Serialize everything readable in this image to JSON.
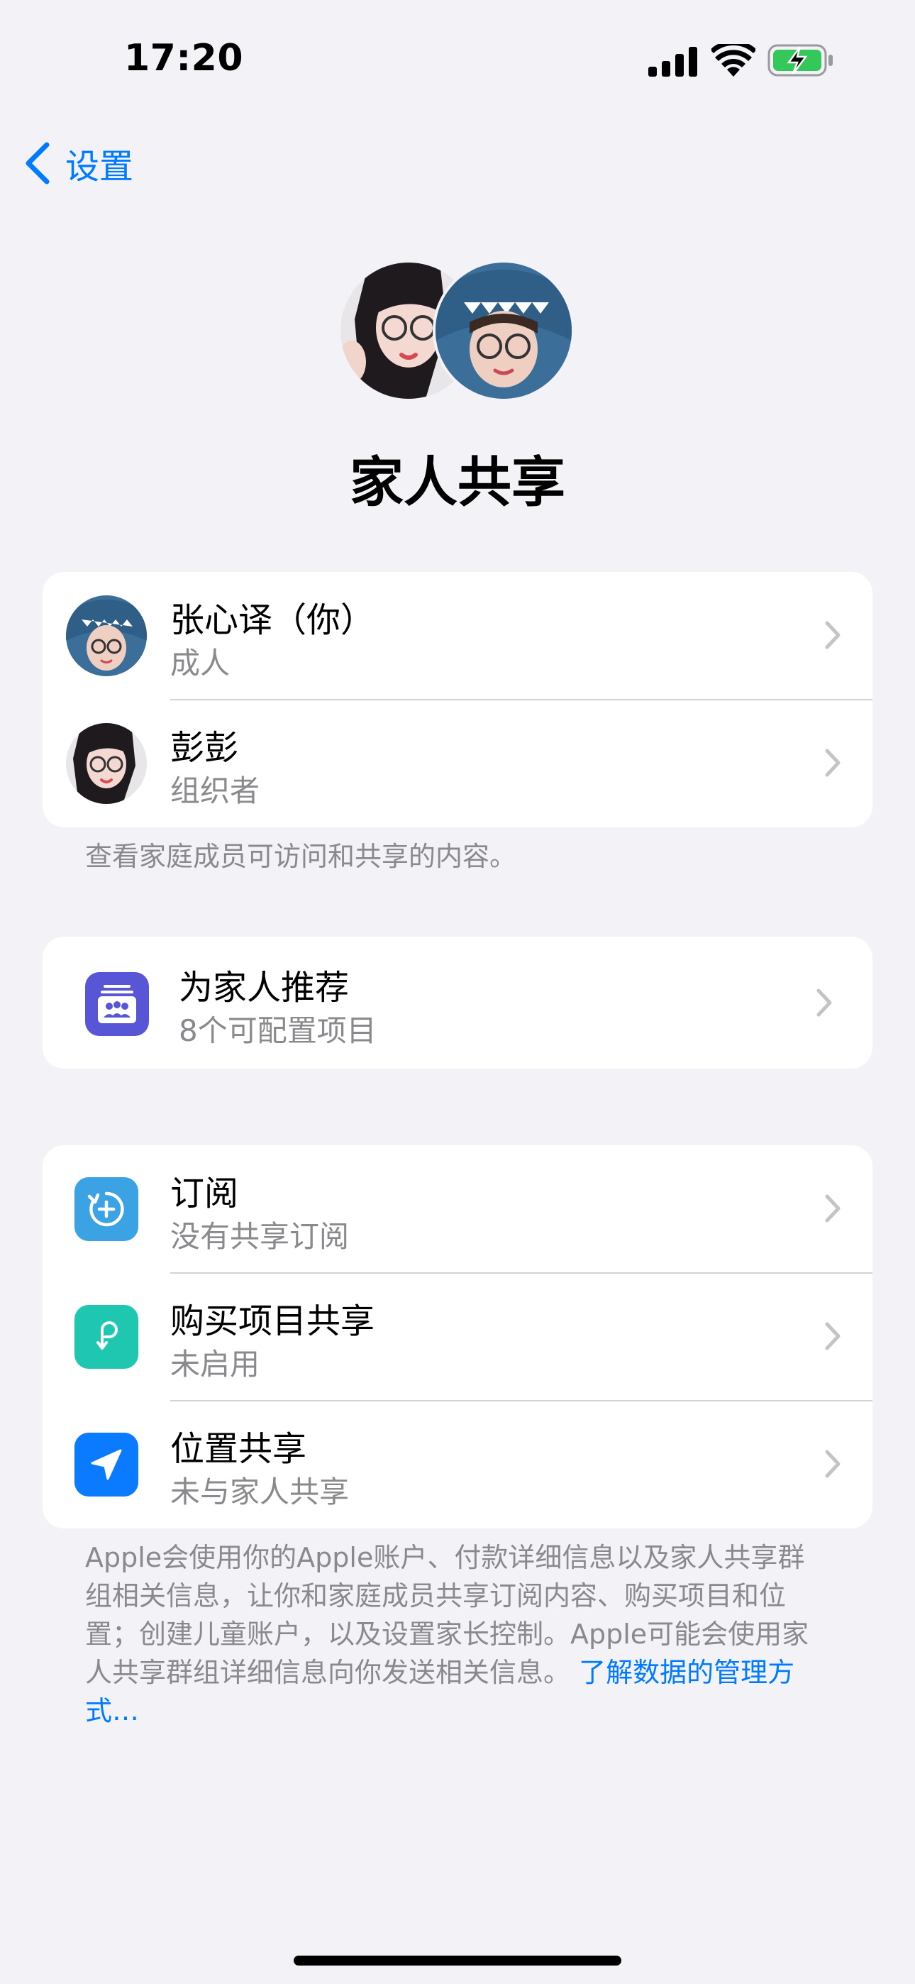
{
  "status_bar": {
    "time": "17:20"
  },
  "nav": {
    "back_label": "设置",
    "back_icon": "chevron-left-icon"
  },
  "header": {
    "title": "家人共享"
  },
  "members": [
    {
      "name": "张心译（你）",
      "role": "成人"
    },
    {
      "name": "彭彭",
      "role": "组织者"
    }
  ],
  "members_note": "查看家庭成员可访问和共享的内容。",
  "recommend": {
    "title": "为家人推荐",
    "subtitle": "8个可配置项目",
    "icon": "family-checklist-icon"
  },
  "features": [
    {
      "title": "订阅",
      "subtitle": "没有共享订阅",
      "icon": "subscription-icon"
    },
    {
      "title": "购买项目共享",
      "subtitle": "未启用",
      "icon": "purchase-sharing-icon"
    },
    {
      "title": "位置共享",
      "subtitle": "未与家人共享",
      "icon": "location-arrow-icon"
    }
  ],
  "footer": {
    "text": "Apple会使用你的Apple账户、付款详细信息以及家人共享群组相关信息，让你和家庭成员共享订阅内容、购买项目和位置；创建儿童账户，以及设置家长控制。Apple可能会使用家人共享群组详细信息向你发送相关信息。",
    "link": "了解数据的管理方式…"
  },
  "colors": {
    "accent": "#007AFF",
    "background": "#F2F2F7",
    "recommend_icon_bg": "#5856D6",
    "subscription_icon_bg": "#3BA3E4",
    "purchase_icon_bg": "#20C7B0",
    "location_icon_bg": "#0A7AFF"
  }
}
